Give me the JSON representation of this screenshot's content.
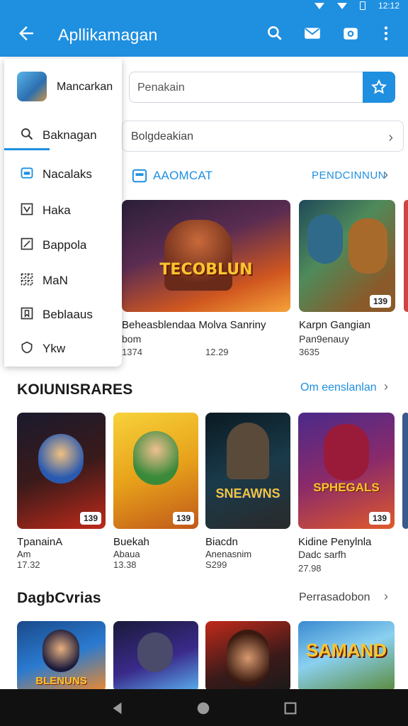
{
  "status": {
    "time": "12:12"
  },
  "appbar": {
    "title": "Apllikamagan"
  },
  "drawer": {
    "header_label": "Mancarkan",
    "items": [
      {
        "label": "Baknagan",
        "icon": "search-icon"
      },
      {
        "label": "Nacalaks",
        "icon": "store-icon"
      },
      {
        "label": "Haka",
        "icon": "check-box-icon"
      },
      {
        "label": "Bappola",
        "icon": "edit-box-icon"
      },
      {
        "label": "MaN",
        "icon": "grid-icon"
      },
      {
        "label": "Beblaaus",
        "icon": "bookmark-box-icon"
      },
      {
        "label": "Ykw",
        "icon": "shield-icon"
      }
    ]
  },
  "search": {
    "placeholder": "Penakain"
  },
  "category_row": {
    "label": "Bolgdeakian"
  },
  "section1": {
    "title": "AAOMCAT",
    "link": "PENDCINNUN",
    "cards": [
      {
        "art_text": "TECOBLUN",
        "title": "Beheasblendaa Molva Sanriny",
        "sub": "bom",
        "left_num": "1374",
        "right_num": "12.29"
      },
      {
        "art_text": "",
        "title": "Karpn Gangian",
        "sub": "Pan9enauy",
        "num": "3635",
        "badge": "139"
      }
    ]
  },
  "section2": {
    "title": "KOIUNISRARES",
    "link": "Om eenslanlan",
    "cards": [
      {
        "title": "TpanainA",
        "sub": "Am",
        "num": "17.32",
        "badge": "139"
      },
      {
        "title": "Buekah",
        "sub": "Abaua",
        "num": "13.38",
        "badge": "139"
      },
      {
        "title": "Biacdn",
        "sub": "Anenasnim",
        "num": "S299",
        "art_text": "SNEAWNS"
      },
      {
        "title": "Kidine Penylnla",
        "sub": "Dadc sarfh",
        "num": "27.98",
        "badge": "139",
        "art_text": "SPHEGALS"
      }
    ]
  },
  "section3": {
    "title": "DagbCvrias",
    "link": "Perrasadobon",
    "cards": [
      {
        "art_text": "BLENUNS"
      },
      {
        "art_text": ""
      },
      {
        "art_text": ""
      },
      {
        "art_text": "SAMAND"
      }
    ]
  }
}
